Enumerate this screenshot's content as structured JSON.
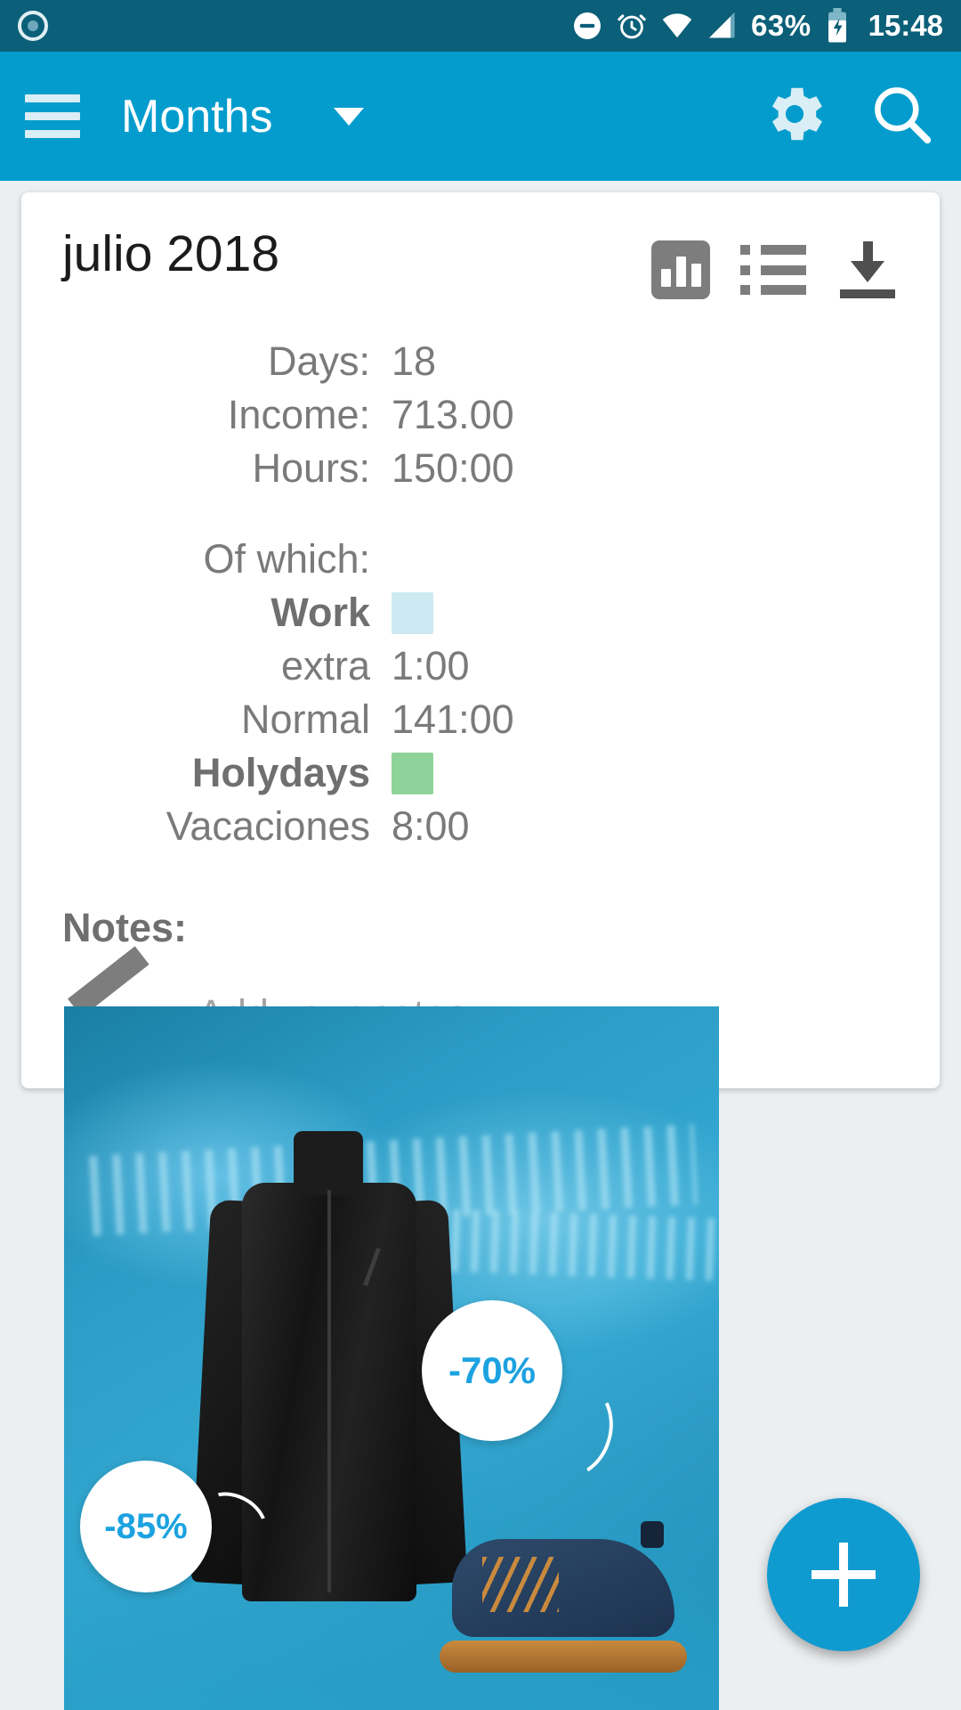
{
  "status_bar": {
    "icons": [
      "do-not-disturb-icon",
      "alarm-icon",
      "wifi-icon",
      "signal-icon",
      "battery-charging-icon"
    ],
    "battery_percent": "63%",
    "clock": "15:48"
  },
  "app_bar": {
    "menu": "menu-icon",
    "title": "Months",
    "dropdown": "chevron-down-icon",
    "settings": "gear-icon",
    "search": "search-icon"
  },
  "card": {
    "title": "julio 2018",
    "actions": {
      "chart": "chart-icon",
      "list": "list-icon",
      "download": "download-icon"
    },
    "stats": [
      {
        "label": "Days:",
        "value": "18"
      },
      {
        "label": "Income:",
        "value": "713.00"
      },
      {
        "label": "Hours:",
        "value": "150:00"
      }
    ],
    "of_which_label": "Of which:",
    "breakdown": [
      {
        "label": "Work",
        "bold": true,
        "value": "",
        "color": "#cdeaf2"
      },
      {
        "label": "extra",
        "bold": false,
        "value": "1:00",
        "color": ""
      },
      {
        "label": "Normal",
        "bold": false,
        "value": "141:00",
        "color": ""
      },
      {
        "label": "Holydays",
        "bold": true,
        "value": "",
        "color": "#8ed49a"
      },
      {
        "label": "Vacaciones",
        "bold": false,
        "value": "8:00",
        "color": ""
      }
    ],
    "notes_title": "Notes:",
    "notes_icon": "pencil-icon",
    "notes_placeholder": "Add your notes"
  },
  "ad": {
    "badge_left": "-85%",
    "badge_right": "-70%",
    "badge_sup": "€"
  },
  "fab": {
    "icon": "plus-icon"
  },
  "colors": {
    "status_bar": "#0b5f78",
    "app_bar": "#039ccd",
    "accent": "#0f9bd0",
    "work_swatch": "#cdeaf2",
    "holyday_swatch": "#8ed49a",
    "text_gray": "#7a7a7a"
  }
}
